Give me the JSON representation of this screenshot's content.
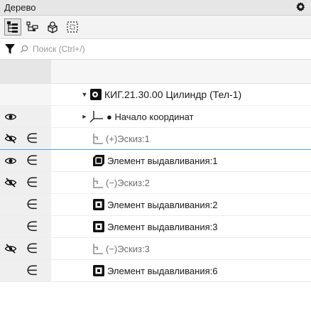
{
  "panel": {
    "title": "Дерево"
  },
  "toolbar": {
    "buttons": [
      {
        "name": "structure-tree-icon",
        "active": true
      },
      {
        "name": "hierarchy-tree-icon",
        "active": false
      },
      {
        "name": "components-view-icon",
        "active": false
      },
      {
        "name": "selection-frame-icon",
        "active": false
      }
    ]
  },
  "filter": {
    "search_placeholder": "Поиск (Ctrl+/)"
  },
  "tree": {
    "root": {
      "label": "КИГ.21.30.00 Цилиндр (Тел-1)",
      "expanded": true
    },
    "items": [
      {
        "label": "● Начало координат",
        "visible": true,
        "owned": false,
        "icon": "origin-axes-icon",
        "dim": false
      },
      {
        "label": "(+)Эскиз:1",
        "visible": false,
        "owned": true,
        "icon": "sketch-icon",
        "dim": true,
        "selected": true
      },
      {
        "label": "Элемент выдавливания:1",
        "visible": true,
        "owned": true,
        "icon": "extrusion-icon",
        "dim": false
      },
      {
        "label": "(−)Эскиз:2",
        "visible": false,
        "owned": true,
        "icon": "sketch-icon",
        "dim": true
      },
      {
        "label": "Элемент выдавливания:2",
        "visible": null,
        "owned": true,
        "icon": "cut-extrusion-icon",
        "dim": false
      },
      {
        "label": "Элемент выдавливания:3",
        "visible": null,
        "owned": true,
        "icon": "cut-extrusion-icon",
        "dim": false
      },
      {
        "label": "(−)Эскиз:3",
        "visible": false,
        "owned": true,
        "icon": "sketch-icon",
        "dim": true
      },
      {
        "label": "Элемент выдавливания:6",
        "visible": null,
        "owned": true,
        "icon": "cut-extrusion-icon",
        "dim": false
      }
    ]
  },
  "symbols": {
    "belongs": "∈"
  }
}
